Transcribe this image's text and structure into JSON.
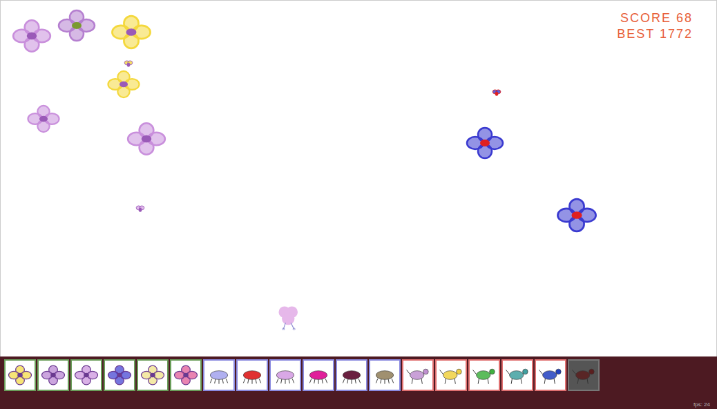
{
  "hud": {
    "score_label": "SCORE",
    "score": "68",
    "best_label": "BEST",
    "best": "1772"
  },
  "sprites": [
    {
      "kind": "flower",
      "color": "#c98fdc",
      "accent": "#9a5ab8"
    },
    {
      "kind": "flower",
      "color": "#b57fd0",
      "accent": "#7a9a30"
    },
    {
      "kind": "flower",
      "color": "#f4d83c",
      "accent": "#9a5ab8"
    },
    {
      "kind": "bug",
      "color": "#f4d83c",
      "accent": "#9a5ab8"
    },
    {
      "kind": "flower",
      "color": "#f4d83c",
      "accent": "#9a5ab8"
    },
    {
      "kind": "flower",
      "color": "#c98fdc",
      "accent": "#9a5ab8"
    },
    {
      "kind": "flower",
      "color": "#c98fdc",
      "accent": "#9a5ab8"
    },
    {
      "kind": "bug",
      "color": "#d9a8e6",
      "accent": "#9a5ab8"
    },
    {
      "kind": "bug",
      "color": "#3a3ad0",
      "accent": "#e02020"
    },
    {
      "kind": "flower",
      "color": "#3a3ad0",
      "accent": "#e02020"
    },
    {
      "kind": "flower",
      "color": "#3a3ad0",
      "accent": "#e02020"
    },
    {
      "kind": "critter",
      "color": "#e6b8ea",
      "accent": "#8a8ad0"
    }
  ],
  "palette": [
    {
      "group": "plants",
      "kind": "flower",
      "color": "#f4d83c",
      "selected": false
    },
    {
      "group": "plants",
      "kind": "flower",
      "color": "#b57fd0",
      "selected": false
    },
    {
      "group": "plants",
      "kind": "flower",
      "color": "#c98fdc",
      "selected": false
    },
    {
      "group": "plants",
      "kind": "flower",
      "color": "#3a3ad0",
      "selected": false
    },
    {
      "group": "plants",
      "kind": "flower",
      "color": "#f0e080",
      "selected": false
    },
    {
      "group": "plants",
      "kind": "flower",
      "color": "#e05090",
      "selected": false
    },
    {
      "group": "insects",
      "kind": "bug",
      "color": "#b0b0f0",
      "selected": false
    },
    {
      "group": "insects",
      "kind": "bug",
      "color": "#e03030",
      "selected": false
    },
    {
      "group": "insects",
      "kind": "bug",
      "color": "#d9a8e6",
      "selected": false
    },
    {
      "group": "insects",
      "kind": "bug",
      "color": "#e0209a",
      "selected": false
    },
    {
      "group": "insects",
      "kind": "bug",
      "color": "#6a2040",
      "selected": false
    },
    {
      "group": "insects",
      "kind": "bug",
      "color": "#a09070",
      "selected": false
    },
    {
      "group": "animals",
      "kind": "beast",
      "color": "#c090d0",
      "selected": false
    },
    {
      "group": "animals",
      "kind": "beast",
      "color": "#f0d040",
      "selected": false
    },
    {
      "group": "animals",
      "kind": "beast",
      "color": "#40b040",
      "selected": false
    },
    {
      "group": "animals",
      "kind": "beast",
      "color": "#40a0a0",
      "selected": false
    },
    {
      "group": "animals",
      "kind": "beast",
      "color": "#2040c0",
      "selected": false
    },
    {
      "group": "animals",
      "kind": "beast",
      "color": "#5a1e1e",
      "selected": true
    }
  ],
  "fps": "fps: 24"
}
